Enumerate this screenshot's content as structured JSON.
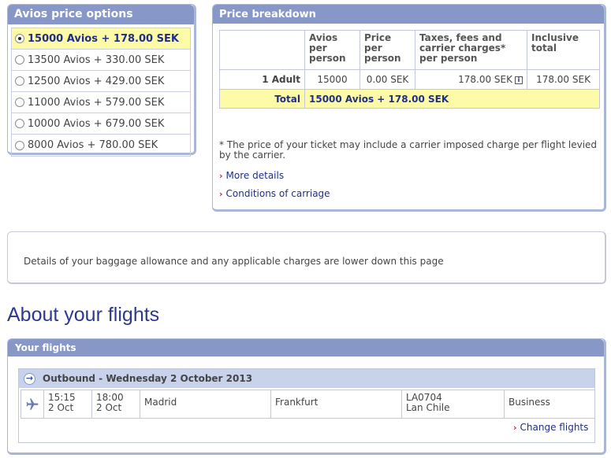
{
  "avios_options": {
    "title": "Avios price options",
    "options": [
      {
        "label": "15000 Avios + 178.00 SEK",
        "selected": true
      },
      {
        "label": "13500 Avios + 330.00 SEK",
        "selected": false
      },
      {
        "label": "12500 Avios + 429.00 SEK",
        "selected": false
      },
      {
        "label": "11000 Avios + 579.00 SEK",
        "selected": false
      },
      {
        "label": "10000 Avios + 679.00 SEK",
        "selected": false
      },
      {
        "label": "8000 Avios + 780.00 SEK",
        "selected": false
      }
    ]
  },
  "price_breakdown": {
    "title": "Price breakdown",
    "headers": [
      "Avios per person",
      "Price per person",
      "Taxes, fees and carrier charges* per person",
      "Inclusive total"
    ],
    "row": {
      "label": "1 Adult",
      "avios": "15000",
      "price": "0.00 SEK",
      "taxes": "178.00 SEK",
      "total": "178.00 SEK"
    },
    "total_label": "Total",
    "total_value": "15000 Avios + 178.00 SEK",
    "note": "* The price of your ticket may include a carrier imposed charge per flight levied by the carrier.",
    "link_more": "More details",
    "link_conditions": "Conditions of carriage",
    "info_glyph": "i"
  },
  "baggage": {
    "text": "Details of your baggage allowance and any applicable charges are lower down this page"
  },
  "about_title": "About your flights",
  "your_flights": {
    "title": "Your flights",
    "outbound_label": "Outbound - Wednesday 2 October 2013",
    "depart_time": "15:15",
    "depart_date": "2 Oct",
    "arrive_time": "18:00",
    "arrive_date": "2 Oct",
    "origin": "Madrid",
    "destination": "Frankfurt",
    "flight_number": "LA0704",
    "carrier": "Lan Chile",
    "cabin": "Business",
    "change_link": "Change flights"
  },
  "colors": {
    "header": "#8797c7",
    "highlight": "#fdfaa8",
    "link": "#1f2f87",
    "chevron": "#c0262d"
  }
}
